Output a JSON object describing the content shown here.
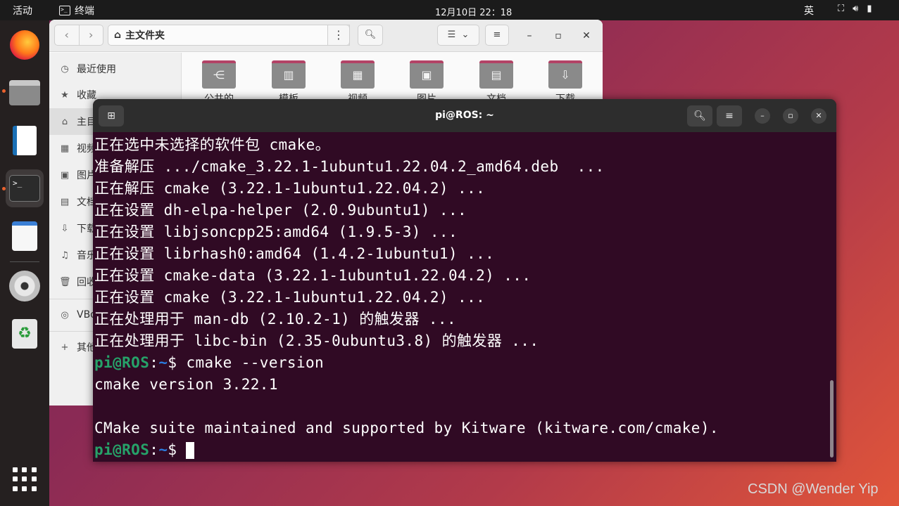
{
  "topbar": {
    "activities": "活动",
    "app_name": "终端",
    "clock": "12月10日  22：18",
    "input_method": "英"
  },
  "dock": {
    "items": [
      "firefox",
      "files",
      "libreoffice-writer",
      "terminal",
      "text-editor",
      "dvd",
      "trash"
    ],
    "show_apps": "show-apps"
  },
  "files": {
    "path": "主文件夹",
    "sidebar": [
      {
        "label": "最近使用",
        "icon": "clock-icon"
      },
      {
        "label": "收藏",
        "icon": "star-icon"
      },
      {
        "label": "主目录",
        "icon": "home-icon"
      },
      {
        "label": "视频",
        "icon": "film-icon"
      },
      {
        "label": "图片",
        "icon": "image-icon"
      },
      {
        "label": "文档",
        "icon": "document-icon"
      },
      {
        "label": "下载",
        "icon": "download-icon"
      },
      {
        "label": "音乐",
        "icon": "music-icon"
      },
      {
        "label": "回收站",
        "icon": "trash-icon"
      },
      {
        "label": "VBox",
        "icon": "disc-icon"
      },
      {
        "label": "其他位置",
        "icon": "plus-icon"
      }
    ],
    "folders": [
      {
        "label": "公共的",
        "icon": "share-icon"
      },
      {
        "label": "模板",
        "icon": "template-icon"
      },
      {
        "label": "视频",
        "icon": "film-icon"
      },
      {
        "label": "图片",
        "icon": "image-icon"
      },
      {
        "label": "文档",
        "icon": "document-icon"
      },
      {
        "label": "下载",
        "icon": "download-icon"
      }
    ]
  },
  "terminal": {
    "title": "pi@ROS: ~",
    "lines": [
      "正在选中未选择的软件包 cmake。",
      "准备解压 .../cmake_3.22.1-1ubuntu1.22.04.2_amd64.deb  ...",
      "正在解压 cmake (3.22.1-1ubuntu1.22.04.2) ...",
      "正在设置 dh-elpa-helper (2.0.9ubuntu1) ...",
      "正在设置 libjsoncpp25:amd64 (1.9.5-3) ...",
      "正在设置 librhash0:amd64 (1.4.2-1ubuntu1) ...",
      "正在设置 cmake-data (3.22.1-1ubuntu1.22.04.2) ...",
      "正在设置 cmake (3.22.1-1ubuntu1.22.04.2) ...",
      "正在处理用于 man-db (2.10.2-1) 的触发器 ...",
      "正在处理用于 libc-bin (2.35-0ubuntu3.8) 的触发器 ..."
    ],
    "prompt_user": "pi@ROS",
    "prompt_sep": ":",
    "prompt_path": "~",
    "prompt_symbol": "$ ",
    "command": "cmake --version",
    "output": [
      "cmake version 3.22.1",
      "",
      "CMake suite maintained and supported by Kitware (kitware.com/cmake)."
    ]
  },
  "watermark": "CSDN @Wender Yip"
}
